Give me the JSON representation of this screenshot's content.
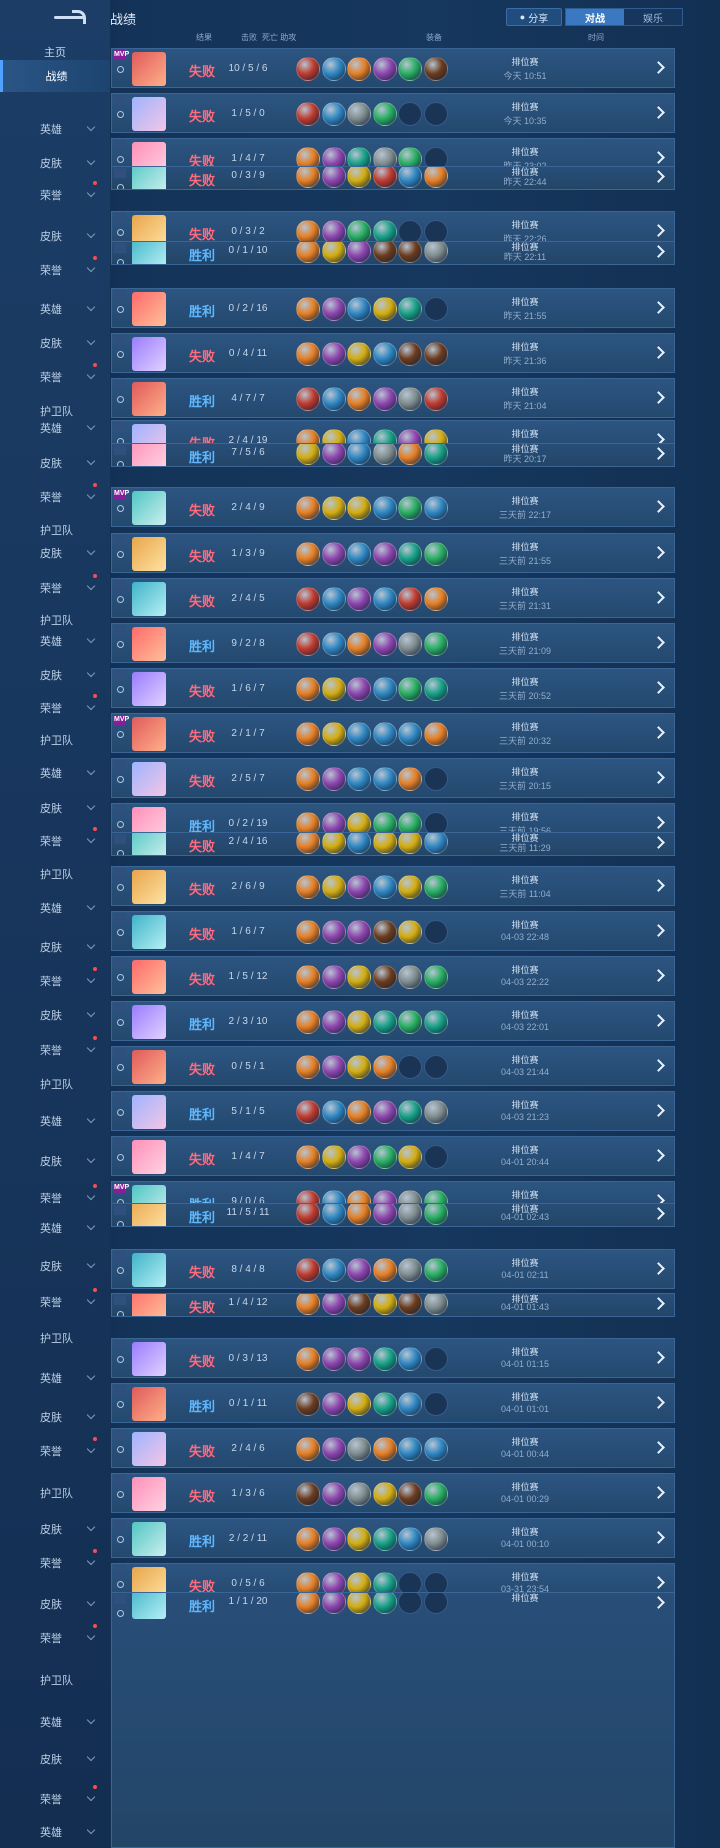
{
  "header": {
    "title": "战绩",
    "share_label": "分享",
    "tabs": [
      {
        "label": "对战",
        "active": true
      },
      {
        "label": "娱乐",
        "active": false
      }
    ]
  },
  "columns": {
    "result": "结果",
    "kills": "击败",
    "deaths_assists": "死亡 助攻",
    "items": "装备",
    "time": "时间"
  },
  "sidebar": {
    "home": "主页",
    "record": "战绩",
    "labels": [
      {
        "t": "英雄"
      },
      {
        "t": "皮肤"
      },
      {
        "t": "荣誉"
      },
      {
        "t": "皮肤"
      },
      {
        "t": "荣誉"
      },
      {
        "t": "英雄"
      },
      {
        "t": "皮肤"
      },
      {
        "t": "荣誉"
      },
      {
        "t": "护卫队"
      },
      {
        "t": "英雄"
      },
      {
        "t": "皮肤"
      },
      {
        "t": "荣誉"
      },
      {
        "t": "护卫队"
      },
      {
        "t": "皮肤"
      },
      {
        "t": "荣誉"
      },
      {
        "t": "护卫队"
      },
      {
        "t": "英雄"
      },
      {
        "t": "皮肤"
      },
      {
        "t": "荣誉"
      },
      {
        "t": "护卫队"
      },
      {
        "t": "英雄"
      },
      {
        "t": "皮肤"
      },
      {
        "t": "荣誉"
      },
      {
        "t": "护卫队"
      },
      {
        "t": "英雄"
      },
      {
        "t": "皮肤"
      },
      {
        "t": "荣誉"
      },
      {
        "t": "皮肤"
      },
      {
        "t": "荣誉"
      },
      {
        "t": "护卫队"
      },
      {
        "t": "英雄"
      },
      {
        "t": "皮肤"
      },
      {
        "t": "荣誉"
      },
      {
        "t": "英雄"
      },
      {
        "t": "皮肤"
      },
      {
        "t": "荣誉"
      },
      {
        "t": "护卫队"
      },
      {
        "t": "英雄"
      },
      {
        "t": "皮肤"
      },
      {
        "t": "荣誉"
      },
      {
        "t": "护卫队"
      },
      {
        "t": "皮肤"
      },
      {
        "t": "荣誉"
      },
      {
        "t": "皮肤"
      },
      {
        "t": "荣誉"
      },
      {
        "t": "护卫队"
      },
      {
        "t": "英雄"
      },
      {
        "t": "皮肤"
      },
      {
        "t": "荣誉"
      },
      {
        "t": "英雄"
      },
      {
        "t": "皮肤"
      },
      {
        "t": "荣誉"
      },
      {
        "t": "英雄"
      },
      {
        "t": "皮肤"
      },
      {
        "t": "荣誉"
      }
    ]
  },
  "colors": {
    "lose": "#ff6a7d",
    "win": "#5fb8ff",
    "mvp_badge": "#8a1e9a",
    "item_palette": [
      "#c0392b",
      "#2e86c1",
      "#e67e22",
      "#8e44ad",
      "#27ae60",
      "#6c3b1c",
      "#7f8c8d",
      "#16a085",
      "#d4ac0d"
    ]
  },
  "matches": [
    {
      "badge": "MVP",
      "result": "失败",
      "type": "lose",
      "kda": "10 / 5 / 6",
      "mode": "排位赛",
      "time": "今天 10:51",
      "items": [
        "blue-boots",
        "purple-spark",
        "ember",
        "red-blade",
        "purple-wand",
        "crimson-staff"
      ]
    },
    {
      "badge": "",
      "result": "失败",
      "type": "lose",
      "kda": "1 / 5 / 0",
      "mode": "排位赛",
      "time": "今天 10:35",
      "items": [
        "blue-boots",
        "purple-spark",
        "violet-star",
        "purple-wand",
        "",
        ""
      ]
    },
    {
      "badge": "",
      "result": "失败",
      "type": "lose",
      "kda": "1 / 4 / 7",
      "mode": "排位赛",
      "time": "昨天 23:02",
      "items": [
        "ember",
        "red-blade",
        "grey-helm",
        "violet-star",
        "purple-wand",
        ""
      ]
    },
    {
      "badge": "",
      "result": "失败",
      "type": "lose",
      "kda": "0 / 3 / 9",
      "mode": "排位赛",
      "time": "昨天 22:44",
      "items": [
        "ember",
        "red-blade",
        "gold-staff",
        "green-arrow",
        "blue-cape",
        "gold-bell"
      ],
      "overlap": true
    },
    {
      "badge": "",
      "result": "失败",
      "type": "lose",
      "kda": "0 / 3 / 2",
      "mode": "排位赛",
      "time": "昨天 22:26",
      "items": [
        "ember",
        "teal-boots",
        "dark-helm",
        "grey-helm",
        "",
        ""
      ]
    },
    {
      "badge": "",
      "result": "胜利",
      "type": "win",
      "kda": "0 / 1 / 10",
      "mode": "排位赛",
      "time": "昨天 22:11",
      "items": [
        "ember",
        "gold-staff",
        "red-blade",
        "green-gem",
        "green-gem",
        "silver-mask"
      ],
      "overlap": true
    },
    {
      "badge": "",
      "result": "胜利",
      "type": "win",
      "kda": "0 / 2 / 16",
      "mode": "排位赛",
      "time": "昨天 21:55",
      "items": [
        "ember",
        "red-blade",
        "blue-cape",
        "gold-staff",
        "brown-book",
        ""
      ]
    },
    {
      "badge": "",
      "result": "失败",
      "type": "lose",
      "kda": "0 / 4 / 11",
      "mode": "排位赛",
      "time": "昨天 21:36",
      "items": [
        "ember",
        "teal-boots",
        "bronze-shield",
        "blue-cape",
        "green-gem",
        "green-gem"
      ]
    },
    {
      "badge": "",
      "result": "胜利",
      "type": "win",
      "kda": "4 / 7 / 7",
      "mode": "排位赛",
      "time": "昨天 21:04",
      "items": [
        "blue-boots",
        "purple-spark",
        "ember",
        "red-blade",
        "violet-star",
        "green-book"
      ]
    },
    {
      "badge": "",
      "result": "失败",
      "type": "lose",
      "kda": "2 / 4 / 19",
      "mode": "排位赛",
      "time": "昨天 20:39",
      "items": [
        "ember",
        "gold-staff",
        "blue-cape",
        "grey-helm",
        "red-blade",
        "bronze-shield"
      ]
    },
    {
      "badge": "",
      "result": "胜利",
      "type": "win",
      "kda": "7 / 5 / 6",
      "mode": "排位赛",
      "time": "昨天 20:17",
      "items": [
        "gold-staff",
        "red-blade",
        "purple-spark",
        "violet-star",
        "ember",
        "brown-book"
      ],
      "overlap": true
    },
    {
      "badge": "MVP",
      "result": "失败",
      "type": "lose",
      "kda": "2 / 4 / 9",
      "mode": "排位赛",
      "time": "三天前 22:17",
      "items": [
        "ember",
        "gold-staff",
        "bronze-shield",
        "blue-cape",
        "dark-helm",
        "red-gem"
      ]
    },
    {
      "badge": "",
      "result": "失败",
      "type": "lose",
      "kda": "1 / 3 / 9",
      "mode": "排位赛",
      "time": "三天前 21:55",
      "items": [
        "ember",
        "red-blade",
        "blue-cape",
        "red-blade",
        "brown-book",
        "dark-helm"
      ]
    },
    {
      "badge": "",
      "result": "失败",
      "type": "lose",
      "kda": "2 / 4 / 5",
      "mode": "排位赛",
      "time": "三天前 21:31",
      "items": [
        "blue-boots",
        "purple-spark",
        "red-blade",
        "blue-cape",
        "green-book",
        "teal-blade"
      ]
    },
    {
      "badge": "",
      "result": "胜利",
      "type": "win",
      "kda": "9 / 2 / 8",
      "mode": "排位赛",
      "time": "三天前 21:09",
      "items": [
        "blue-boots",
        "purple-spark",
        "ember",
        "red-blade",
        "violet-star",
        "purple-wand"
      ]
    },
    {
      "badge": "",
      "result": "失败",
      "type": "lose",
      "kda": "1 / 6 / 7",
      "mode": "排位赛",
      "time": "三天前 20:52",
      "items": [
        "ember",
        "gold-staff",
        "teal-boots",
        "blue-cape",
        "purple-wand",
        "brown-book"
      ]
    },
    {
      "badge": "MVP",
      "result": "失败",
      "type": "lose",
      "kda": "2 / 1 / 7",
      "mode": "排位赛",
      "time": "三天前 20:32",
      "items": [
        "ember",
        "gold-staff",
        "blue-cape",
        "blue-cape",
        "blue-cape",
        "gold-bell"
      ]
    },
    {
      "badge": "",
      "result": "失败",
      "type": "lose",
      "kda": "2 / 5 / 7",
      "mode": "排位赛",
      "time": "三天前 20:15",
      "items": [
        "ember",
        "red-blade",
        "blue-cape",
        "blue-cape",
        "gold-bell",
        ""
      ]
    },
    {
      "badge": "",
      "result": "胜利",
      "type": "win",
      "kda": "0 / 2 / 19",
      "mode": "排位赛",
      "time": "三天前 19:56",
      "items": [
        "ember",
        "red-blade",
        "bronze-shield",
        "purple-wand",
        "purple-wand",
        ""
      ]
    },
    {
      "badge": "",
      "result": "失败",
      "type": "lose",
      "kda": "2 / 4 / 16",
      "mode": "排位赛",
      "time": "三天前 11:29",
      "items": [
        "ember",
        "gold-staff",
        "blue-cape",
        "gold-staff",
        "bronze-shield",
        "blue-cape"
      ],
      "overlap": true
    },
    {
      "badge": "",
      "result": "失败",
      "type": "lose",
      "kda": "2 / 6 / 9",
      "mode": "排位赛",
      "time": "三天前 11:04",
      "items": [
        "ember",
        "gold-staff",
        "red-blade",
        "blue-cape",
        "bronze-shield",
        "purple-wand"
      ]
    },
    {
      "badge": "",
      "result": "失败",
      "type": "lose",
      "kda": "1 / 6 / 7",
      "mode": "排位赛",
      "time": "04-03 22:48",
      "items": [
        "ember",
        "teal-boots",
        "red-blade",
        "green-gem",
        "bronze-shield",
        ""
      ]
    },
    {
      "badge": "",
      "result": "失败",
      "type": "lose",
      "kda": "1 / 5 / 12",
      "mode": "排位赛",
      "time": "04-03 22:22",
      "items": [
        "ember",
        "teal-boots",
        "gold-staff",
        "green-gem",
        "violet-star",
        "dark-helm"
      ]
    },
    {
      "badge": "",
      "result": "胜利",
      "type": "win",
      "kda": "2 / 3 / 10",
      "mode": "排位赛",
      "time": "04-03 22:01",
      "items": [
        "ember",
        "teal-boots",
        "bronze-shield",
        "grey-helm",
        "purple-wand",
        "brown-book"
      ]
    },
    {
      "badge": "",
      "result": "失败",
      "type": "lose",
      "kda": "0 / 5 / 1",
      "mode": "排位赛",
      "time": "04-03 21:44",
      "items": [
        "ember",
        "teal-boots",
        "bronze-shield",
        "gold-bell",
        "",
        ""
      ]
    },
    {
      "badge": "",
      "result": "胜利",
      "type": "win",
      "kda": "5 / 1 / 5",
      "mode": "排位赛",
      "time": "04-03 21:23",
      "items": [
        "blue-boots",
        "purple-spark",
        "ember",
        "red-blade",
        "brown-book",
        "violet-star"
      ]
    },
    {
      "badge": "",
      "result": "失败",
      "type": "lose",
      "kda": "1 / 4 / 7",
      "mode": "排位赛",
      "time": "04-01 20:44",
      "items": [
        "ember",
        "bronze-shield",
        "red-blade",
        "purple-wand",
        "bronze-shield",
        ""
      ]
    },
    {
      "badge": "MVP",
      "result": "胜利",
      "type": "win",
      "kda": "9 / 0 / 6",
      "mode": "排位赛",
      "time": "04-01 20:23",
      "items": [
        "blue-boots",
        "purple-spark",
        "ember",
        "red-blade",
        "violet-star",
        "purple-wand"
      ]
    },
    {
      "badge": "",
      "result": "胜利",
      "type": "win",
      "kda": "11 / 5 / 11",
      "mode": "排位赛",
      "time": "04-01 02:43",
      "items": [
        "blue-boots",
        "purple-spark",
        "ember",
        "red-blade",
        "violet-star",
        "purple-wand"
      ],
      "overlap": true
    },
    {
      "badge": "",
      "result": "失败",
      "type": "lose",
      "kda": "8 / 4 / 8",
      "mode": "排位赛",
      "time": "04-01 02:11",
      "items": [
        "blue-boots",
        "purple-spark",
        "red-blade",
        "ember",
        "violet-star",
        "purple-wand"
      ]
    },
    {
      "badge": "",
      "result": "失败",
      "type": "lose",
      "kda": "1 / 4 / 12",
      "mode": "排位赛",
      "time": "04-01 01:43",
      "items": [
        "ember",
        "teal-boots",
        "green-gem",
        "gold-staff",
        "green-gem",
        "silver-mask"
      ],
      "overlap": true
    },
    {
      "badge": "",
      "result": "失败",
      "type": "lose",
      "kda": "0 / 3 / 13",
      "mode": "排位赛",
      "time": "04-01 01:15",
      "items": [
        "ember",
        "teal-boots",
        "red-blade",
        "grey-helm",
        "blue-cape",
        ""
      ]
    },
    {
      "badge": "",
      "result": "胜利",
      "type": "win",
      "kda": "0 / 1 / 11",
      "mode": "排位赛",
      "time": "04-01 01:01",
      "items": [
        "green-gem",
        "teal-boots",
        "bronze-shield",
        "brown-book",
        "red-gem",
        ""
      ]
    },
    {
      "badge": "",
      "result": "失败",
      "type": "lose",
      "kda": "2 / 4 / 6",
      "mode": "排位赛",
      "time": "04-01 00:44",
      "items": [
        "ember",
        "teal-boots",
        "violet-star",
        "ember",
        "red-gem",
        "red-gem"
      ]
    },
    {
      "badge": "",
      "result": "失败",
      "type": "lose",
      "kda": "1 / 3 / 6",
      "mode": "排位赛",
      "time": "04-01 00:29",
      "items": [
        "green-gem",
        "teal-boots",
        "silver-mask",
        "bronze-shield",
        "green-gem",
        "purple-wand"
      ]
    },
    {
      "badge": "",
      "result": "胜利",
      "type": "win",
      "kda": "2 / 2 / 11",
      "mode": "排位赛",
      "time": "04-01 00:10",
      "items": [
        "ember",
        "teal-boots",
        "bronze-shield",
        "grey-helm",
        "red-gem",
        "silver-mask"
      ]
    },
    {
      "badge": "",
      "result": "失败",
      "type": "lose",
      "kda": "0 / 5 / 6",
      "mode": "排位赛",
      "time": "03-31 23:54",
      "items": [
        "ember",
        "teal-boots",
        "bronze-shield",
        "grey-helm",
        "",
        ""
      ]
    },
    {
      "badge": "",
      "result": "胜利",
      "type": "win",
      "kda": "1 / 1 / 20",
      "mode": "排位赛",
      "time": "",
      "items": [
        "ember",
        "teal-boots",
        "bronze-shield",
        "grey-helm",
        "",
        ""
      ],
      "overlap": true
    }
  ]
}
